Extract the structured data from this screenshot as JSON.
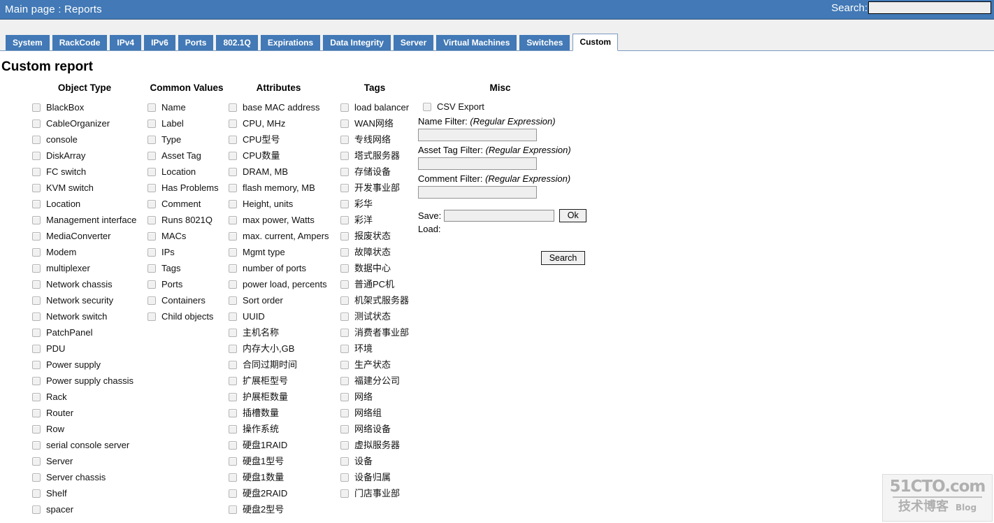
{
  "header": {
    "breadcrumb": "Main page : Reports",
    "search_label": "Search:",
    "search_value": "",
    "search_placeholder": "",
    "bar_color": "#4279b6"
  },
  "tabs": [
    {
      "label": "System",
      "active": false
    },
    {
      "label": "RackCode",
      "active": false
    },
    {
      "label": "IPv4",
      "active": false
    },
    {
      "label": "IPv6",
      "active": false
    },
    {
      "label": "Ports",
      "active": false
    },
    {
      "label": "802.1Q",
      "active": false
    },
    {
      "label": "Expirations",
      "active": false
    },
    {
      "label": "Data Integrity",
      "active": false
    },
    {
      "label": "Server",
      "active": false
    },
    {
      "label": "Virtual Machines",
      "active": false
    },
    {
      "label": "Switches",
      "active": false
    },
    {
      "label": "Custom",
      "active": true
    }
  ],
  "page_title": "Custom report",
  "columns": {
    "object_type": {
      "heading": "Object Type",
      "items": [
        "BlackBox",
        "CableOrganizer",
        "console",
        "DiskArray",
        "FC switch",
        "KVM switch",
        "Location",
        "Management interface",
        "MediaConverter",
        "Modem",
        "multiplexer",
        "Network chassis",
        "Network security",
        "Network switch",
        "PatchPanel",
        "PDU",
        "Power supply",
        "Power supply chassis",
        "Rack",
        "Router",
        "Row",
        "serial console server",
        "Server",
        "Server chassis",
        "Shelf",
        "spacer"
      ]
    },
    "common_values": {
      "heading": "Common Values",
      "items": [
        "Name",
        "Label",
        "Type",
        "Asset Tag",
        "Location",
        "Has Problems",
        "Comment",
        "Runs 8021Q",
        "MACs",
        "IPs",
        "Tags",
        "Ports",
        "Containers",
        "Child objects"
      ]
    },
    "attributes": {
      "heading": "Attributes",
      "items": [
        "base MAC address",
        "CPU, MHz",
        "CPU型号",
        "CPU数量",
        "DRAM, MB",
        "flash memory, MB",
        "Height, units",
        "max power, Watts",
        "max. current, Ampers",
        "Mgmt type",
        "number of ports",
        "power load, percents",
        "Sort order",
        "UUID",
        "主机名称",
        "内存大小,GB",
        "合同过期时间",
        "扩展柜型号",
        "护展柜数量",
        "插槽数量",
        "操作系统",
        "硬盘1RAID",
        "硬盘1型号",
        "硬盘1数量",
        "硬盘2RAID",
        "硬盘2型号"
      ]
    },
    "tags": {
      "heading": "Tags",
      "items": [
        "load balancer",
        "WAN网络",
        "专线网络",
        "塔式服务器",
        "存储设备",
        "开发事业部",
        "彩华",
        "彩洋",
        "报废状态",
        "故障状态",
        "数据中心",
        "普通PC机",
        "机架式服务器",
        "测试状态",
        "消费者事业部",
        "环境",
        "生产状态",
        "福建分公司",
        "网络",
        "网络组",
        "网络设备",
        "虚拟服务器",
        "设备",
        "设备归属",
        "门店事业部"
      ]
    },
    "misc": {
      "heading": "Misc",
      "csv_export_label": "CSV Export",
      "name_filter_label": "Name Filter:",
      "name_filter_hint": "(Regular Expression)",
      "name_filter_value": "",
      "asset_tag_filter_label": "Asset Tag Filter:",
      "asset_tag_filter_hint": "(Regular Expression)",
      "asset_tag_filter_value": "",
      "comment_filter_label": "Comment Filter:",
      "comment_filter_hint": "(Regular Expression)",
      "comment_filter_value": "",
      "save_label": "Save:",
      "save_value": "",
      "ok_label": "Ok",
      "load_label": "Load:",
      "search_button_label": "Search"
    }
  },
  "watermark": {
    "top": "51CTO.com",
    "bottom_cn": "技术博客",
    "bottom_en": "Blog"
  }
}
